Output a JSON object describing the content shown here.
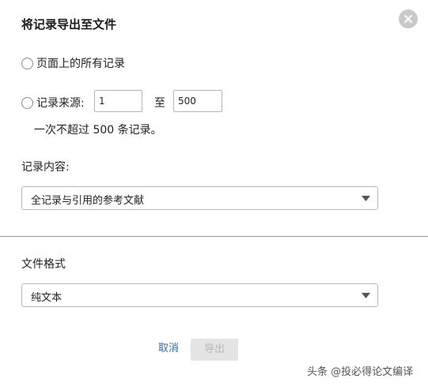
{
  "dialog": {
    "title": "将记录导出至文件",
    "close_icon": "close-icon"
  },
  "record_range": {
    "all_label": "页面上的所有记录",
    "source_label": "记录来源:",
    "from_value": "1",
    "to_label": "至",
    "to_value": "500",
    "limit_note": "一次不超过 500 条记录。"
  },
  "content": {
    "label": "记录内容:",
    "selected": "全记录与引用的参考文献"
  },
  "format": {
    "label": "文件格式",
    "selected": "纯文本"
  },
  "actions": {
    "cancel_label": "取消",
    "export_label": "导出"
  },
  "watermark": "头条 @投必得论文编译"
}
